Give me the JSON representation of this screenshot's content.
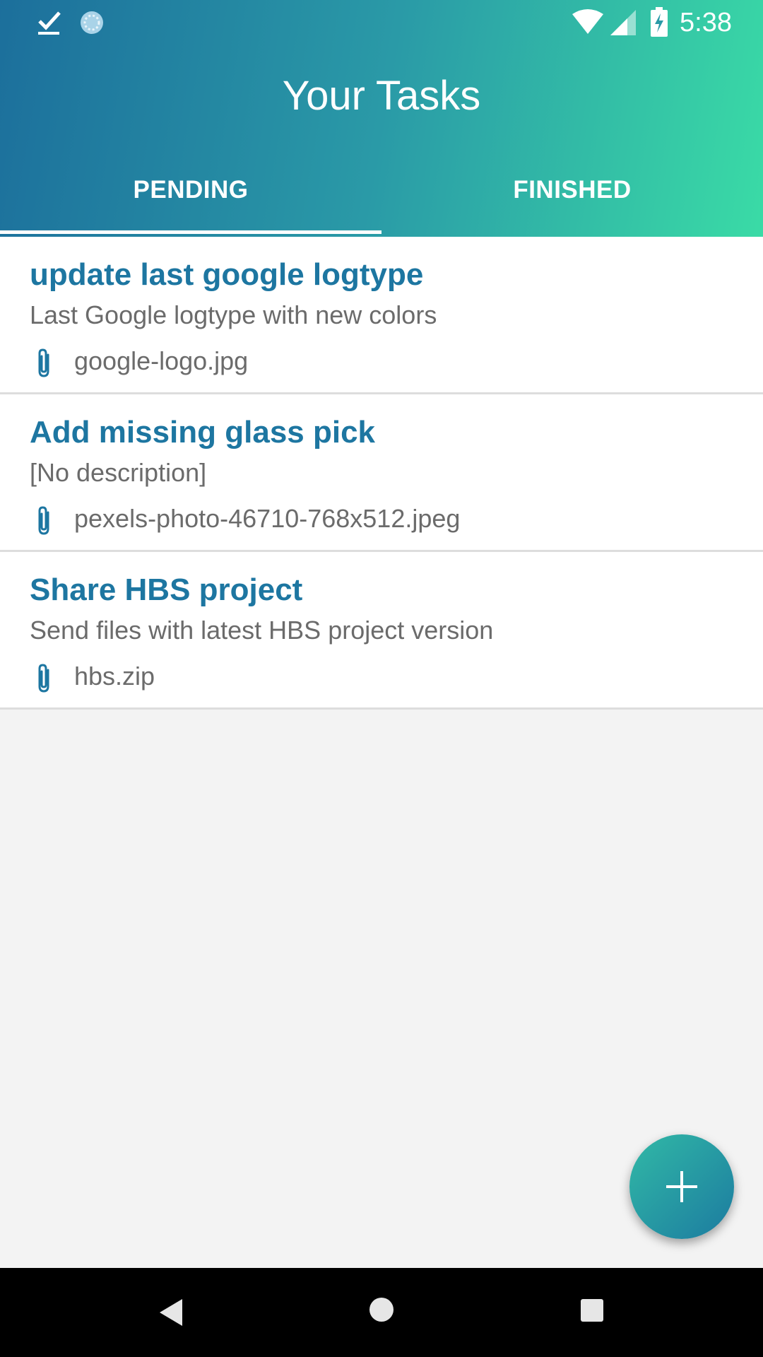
{
  "status_bar": {
    "time": "5:38",
    "icons": [
      "check-icon",
      "sync-icon",
      "wifi-icon",
      "signal-icon",
      "battery-charging-icon"
    ]
  },
  "app": {
    "title": "Your Tasks"
  },
  "tabs": [
    {
      "label": "PENDING",
      "selected": true
    },
    {
      "label": "FINISHED",
      "selected": false
    }
  ],
  "tasks": [
    {
      "title": "update last google logtype",
      "description": "Last Google logtype with new colors",
      "attachment": "google-logo.jpg"
    },
    {
      "title": "Add missing glass pick",
      "description": "[No description]",
      "attachment": "pexels-photo-46710-768x512.jpeg"
    },
    {
      "title": "Share HBS project",
      "description": "Send files with latest HBS project version",
      "attachment": "hbs.zip"
    }
  ],
  "fab": {
    "icon": "plus-icon"
  },
  "nav_bar": {
    "icons": [
      "back-icon",
      "home-icon",
      "recents-icon"
    ]
  },
  "colors": {
    "header_gradient_start": "#1c6f9c",
    "header_gradient_end": "#3adba6",
    "task_title": "#1d76a1",
    "secondary_text": "#6b6b6b",
    "background": "#f3f3f3"
  }
}
